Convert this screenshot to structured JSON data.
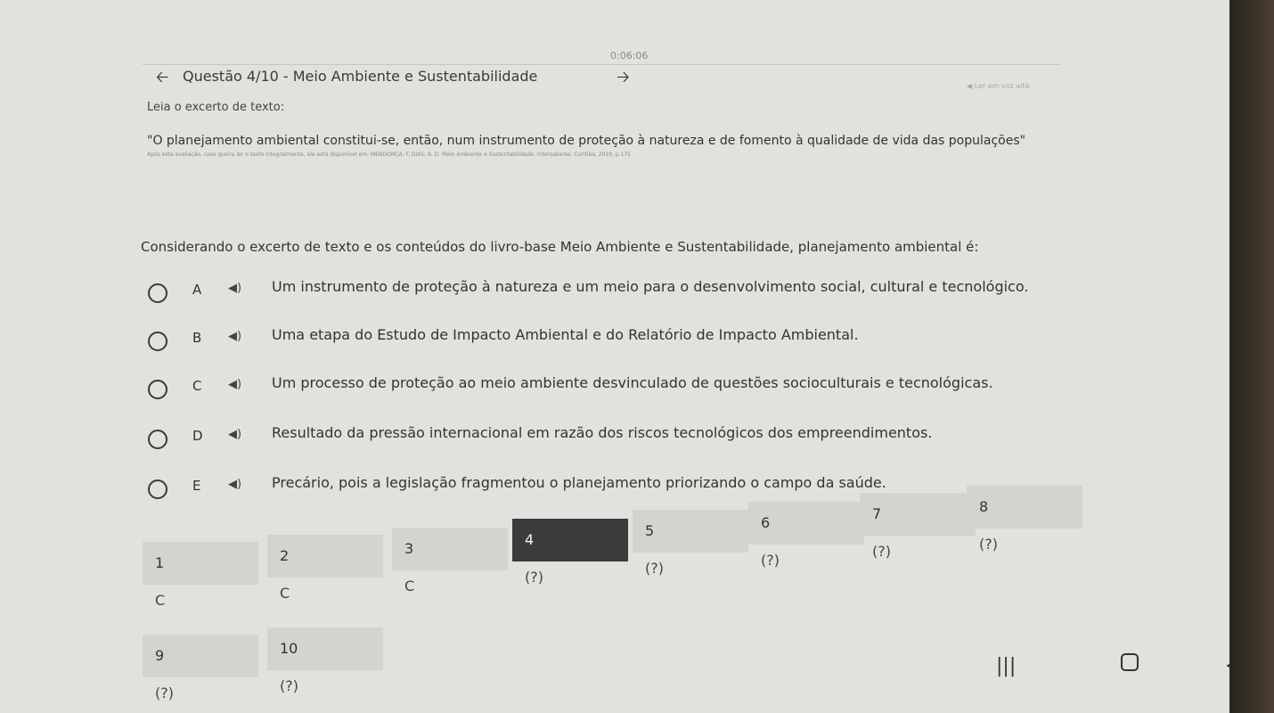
{
  "header": {
    "timer": "0:06:06",
    "title": "Questão 4/10 - Meio Ambiente e Sustentabilidade",
    "read_aloud": "Ler em voz alta"
  },
  "content": {
    "instruction": "Leia o excerto de texto:",
    "quote": "\"O planejamento ambiental constitui-se, então, num instrumento de proteção à natureza e de fomento à qualidade de vida das populações\"",
    "source": "Após esta avaliação, caso queira ler o texto integralmente, ele está disponível em: MENDONÇA, F. DIAS, A. D. Meio Ambiente e Sustentabilidade. Intersaberes. Curitiba, 2019, p.175",
    "question": "Considerando o excerto de texto e os conteúdos do livro-base Meio Ambiente e Sustentabilidade, planejamento ambiental é:"
  },
  "options": [
    {
      "letter": "A",
      "text": "Um instrumento de proteção à natureza e um meio para o desenvolvimento social, cultural e tecnológico."
    },
    {
      "letter": "B",
      "text": "Uma etapa do Estudo de Impacto Ambiental e do Relatório de Impacto Ambiental."
    },
    {
      "letter": "C",
      "text": "Um processo de proteção ao meio ambiente desvinculado de questões socioculturais e tecnológicas."
    },
    {
      "letter": "D",
      "text": "Resultado da pressão internacional em razão dos riscos tecnológicos dos empreendimentos."
    },
    {
      "letter": "E",
      "text": "Precário, pois a legislação fragmentou o planejamento priorizando o campo da saúde."
    }
  ],
  "question_nav": [
    {
      "number": "1",
      "answer": "C"
    },
    {
      "number": "2",
      "answer": "C"
    },
    {
      "number": "3",
      "answer": "C"
    },
    {
      "number": "4",
      "answer": "(?)"
    },
    {
      "number": "5",
      "answer": "(?)"
    },
    {
      "number": "6",
      "answer": "(?)"
    },
    {
      "number": "7",
      "answer": "(?)"
    },
    {
      "number": "8",
      "answer": "(?)"
    },
    {
      "number": "9",
      "answer": "(?)"
    },
    {
      "number": "10",
      "answer": "(?)"
    }
  ],
  "icons": {
    "back": "arrow-left-icon",
    "forward": "arrow-right-icon",
    "speaker": "speaker-icon",
    "recent_apps": "recent-apps-icon",
    "home": "home-icon",
    "system_back": "chevron-left-icon"
  },
  "colors": {
    "background": "#e2e1de",
    "nav_tile": "#d4d3cf",
    "current_tile": "#3b3b3b"
  }
}
